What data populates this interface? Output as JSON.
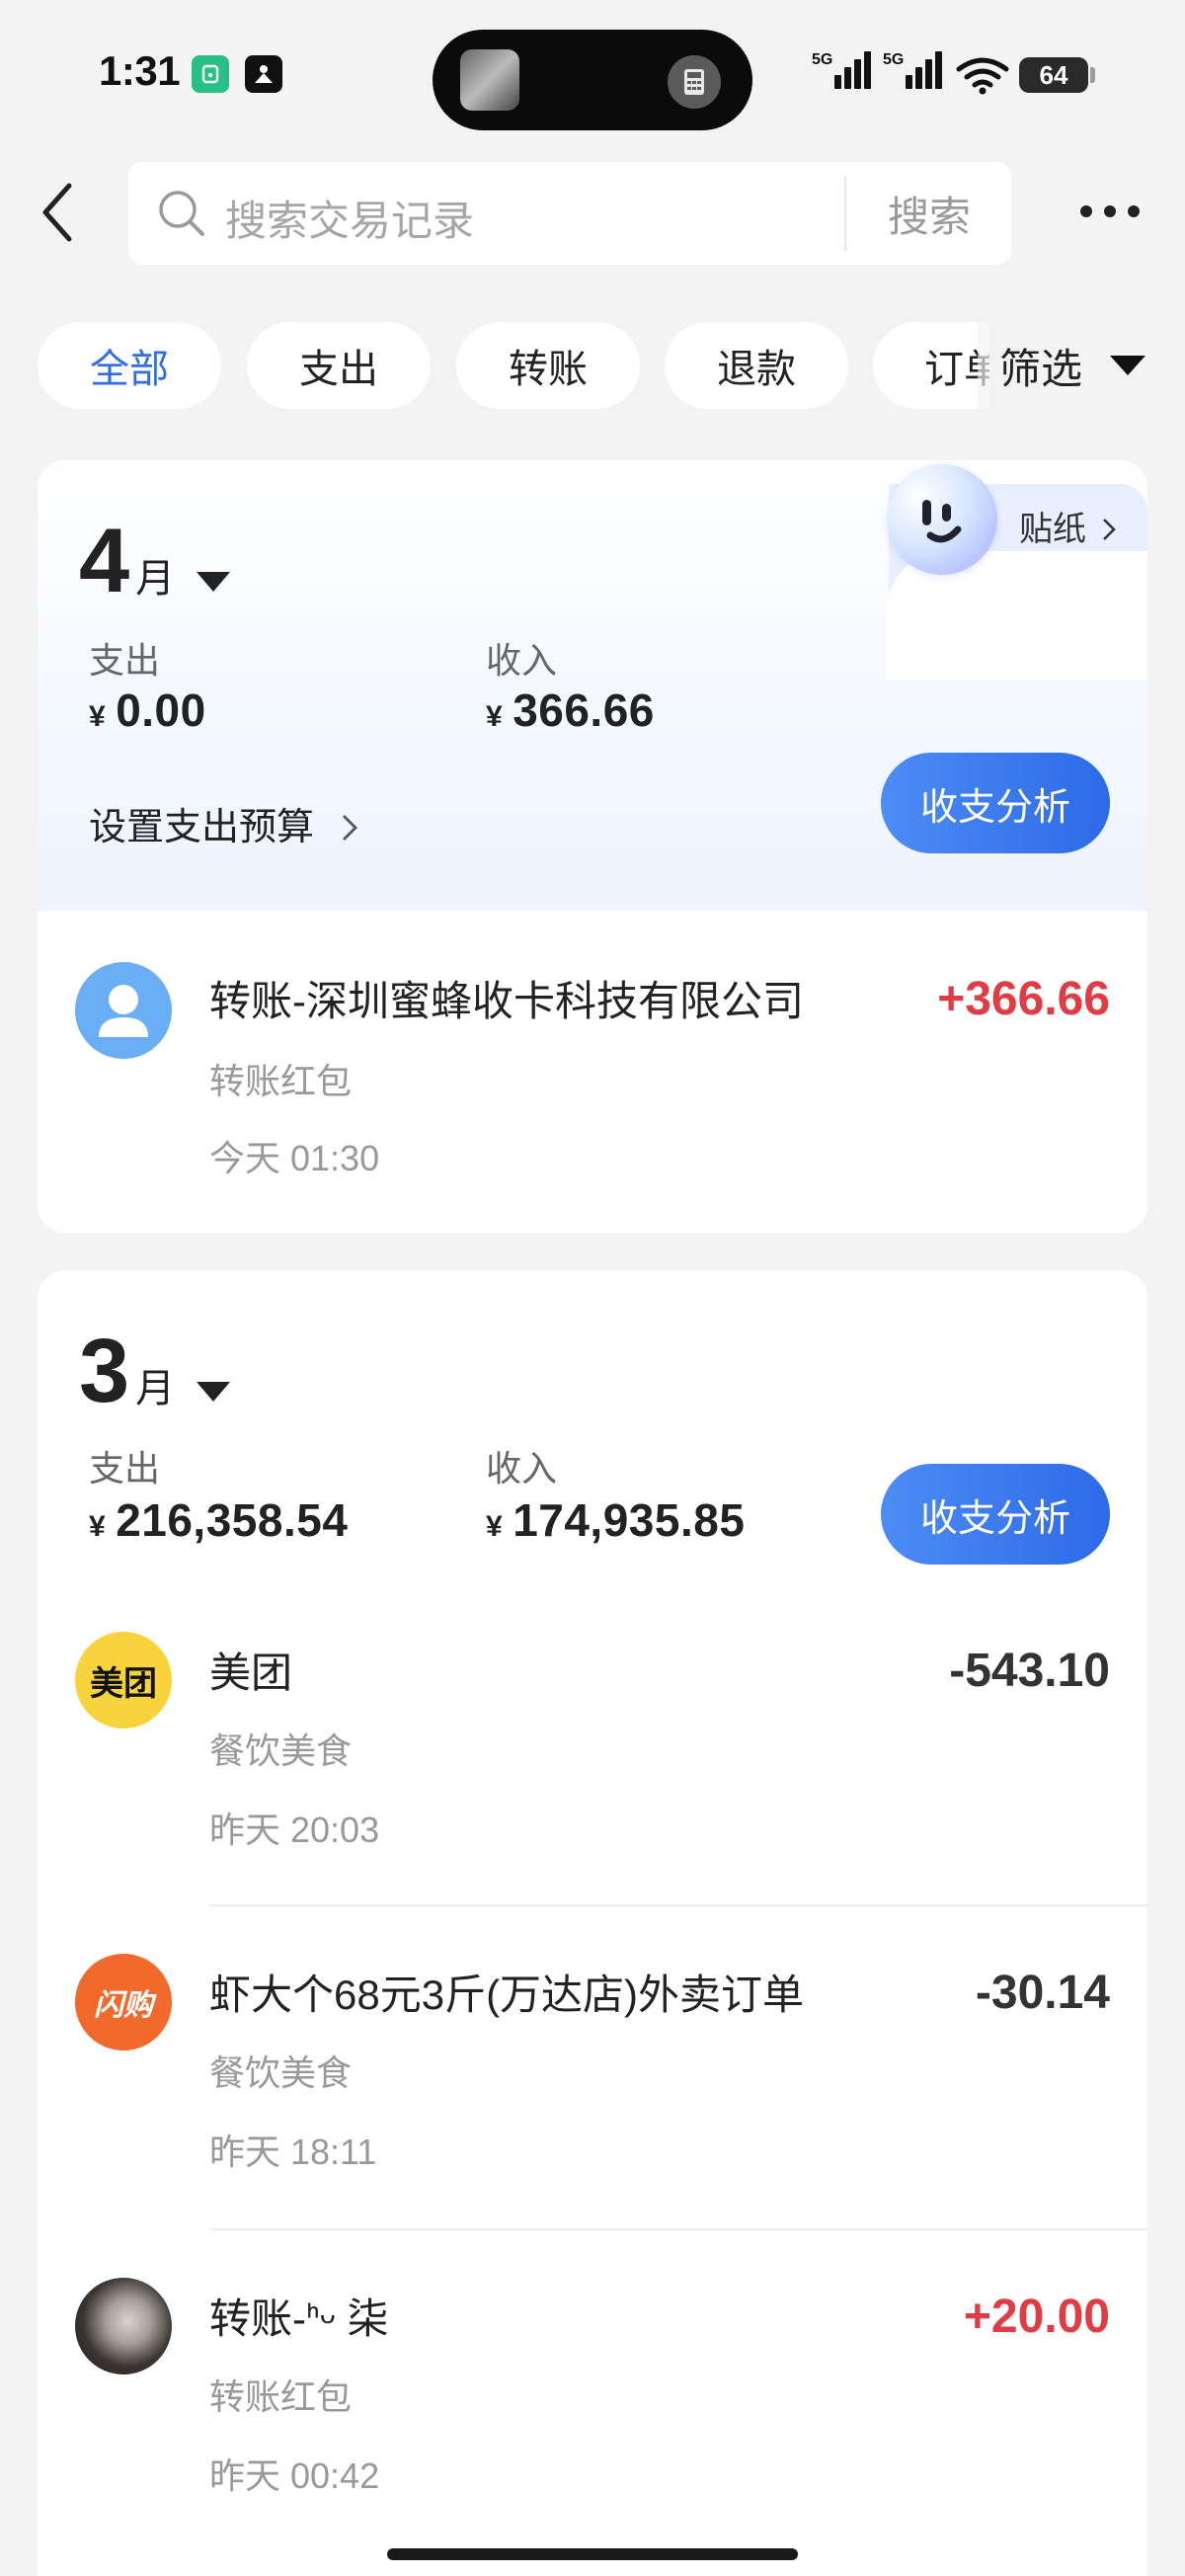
{
  "status_bar": {
    "time": "1:31",
    "signal_1": "5G",
    "signal_2": "5G",
    "battery": "64"
  },
  "search": {
    "placeholder": "搜索交易记录",
    "button": "搜索"
  },
  "filters": {
    "chips": [
      "全部",
      "支出",
      "转账",
      "退款",
      "订单"
    ],
    "active": "全部",
    "filter_label": "筛选"
  },
  "sticker": {
    "label": "贴纸"
  },
  "months": [
    {
      "month": "4",
      "unit": "月",
      "expense_label": "支出",
      "expense": "0.00",
      "income_label": "收入",
      "income": "366.66",
      "currency": "¥",
      "budget_link": "设置支出预算",
      "analysis_button": "收支分析",
      "transactions": [
        {
          "title": "转账-深圳蜜蜂收卡科技有限公司",
          "category": "转账红包",
          "time": "今天 01:30",
          "amount": "+366.66",
          "icon": "user-avatar-icon"
        }
      ]
    },
    {
      "month": "3",
      "unit": "月",
      "expense_label": "支出",
      "expense": "216,358.54",
      "income_label": "收入",
      "income": "174,935.85",
      "currency": "¥",
      "analysis_button": "收支分析",
      "transactions": [
        {
          "title": "美团",
          "category": "餐饮美食",
          "time": "昨天 20:03",
          "amount": "-543.10",
          "icon": "meituan-logo",
          "logo_text": "美团"
        },
        {
          "title": "虾大个68元3斤(万达店)外卖订单",
          "category": "餐饮美食",
          "time": "昨天 18:11",
          "amount": "-30.14",
          "icon": "shangou-logo",
          "logo_text": "闪购"
        },
        {
          "title": "转账-ᑋᵕ 柒",
          "category": "转账红包",
          "time": "昨天 00:42",
          "amount": "+20.00",
          "icon": "contact-photo"
        }
      ]
    }
  ],
  "colors": {
    "accent": "#2f6ee3",
    "positive": "#e03c45",
    "meituan": "#f8d33b",
    "shangou": "#f26a2b",
    "background": "#f3f3f3"
  }
}
